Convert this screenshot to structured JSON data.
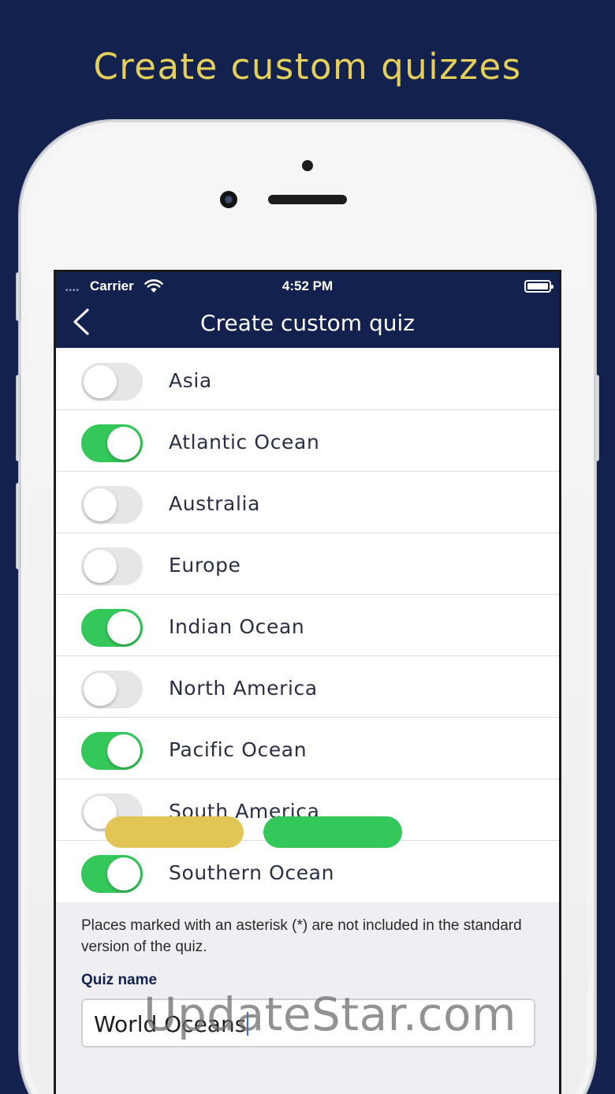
{
  "headline": "Create custom quizzes",
  "status_bar": {
    "signal": "••••",
    "carrier": "Carrier",
    "time": "4:52 PM"
  },
  "nav": {
    "title": "Create custom quiz"
  },
  "regions": [
    {
      "label": "Asia",
      "enabled": false
    },
    {
      "label": "Atlantic Ocean",
      "enabled": true
    },
    {
      "label": "Australia",
      "enabled": false
    },
    {
      "label": "Europe",
      "enabled": false
    },
    {
      "label": "Indian Ocean",
      "enabled": true
    },
    {
      "label": "North America",
      "enabled": false
    },
    {
      "label": "Pacific Ocean",
      "enabled": true
    },
    {
      "label": "South America",
      "enabled": false
    },
    {
      "label": "Southern Ocean",
      "enabled": true
    }
  ],
  "footnote": "Places marked with an asterisk (*) are not included in the standard version of the quiz.",
  "quiz_name": {
    "label": "Quiz name",
    "value": "World Oceans"
  },
  "watermark": "UpdateStar.com",
  "colors": {
    "background": "#13214f",
    "headline": "#e3cf5a",
    "toggle_on": "#34c759",
    "toggle_off": "#e6e6e8"
  }
}
